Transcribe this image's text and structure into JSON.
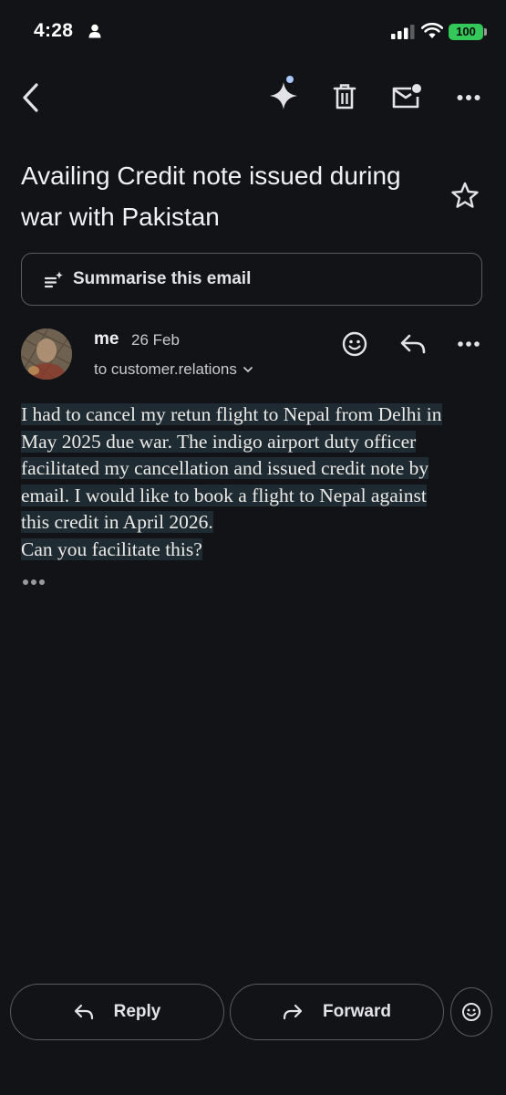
{
  "status_bar": {
    "time": "4:28",
    "battery": "100"
  },
  "toolbar": {
    "icons": [
      "back-arrow-icon",
      "gemini-sparkle-icon",
      "trash-icon",
      "mark-unread-icon",
      "more-horizontal-icon"
    ]
  },
  "email": {
    "subject": "Availing Credit note issued during war with Pakistan",
    "summarise_label": "Summarise this email",
    "sender": "me",
    "date": "26 Feb",
    "recipient": "to customer.relations",
    "body_lines": [
      "I had to cancel my retun flight to Nepal from Delhi in",
      "May 2025 due war. The indigo airport duty officer",
      "facilitated my cancellation and issued credit note by",
      "email. I would like to book a flight to Nepal against",
      "this credit in April 2026.",
      "Can you facilitate this?"
    ]
  },
  "actions": {
    "reply_label": "Reply",
    "forward_label": "Forward"
  },
  "colors": {
    "background": "#121316",
    "highlight": "#1f2b33",
    "battery": "#34c759",
    "sparkle_dot": "#a8c7fa"
  }
}
